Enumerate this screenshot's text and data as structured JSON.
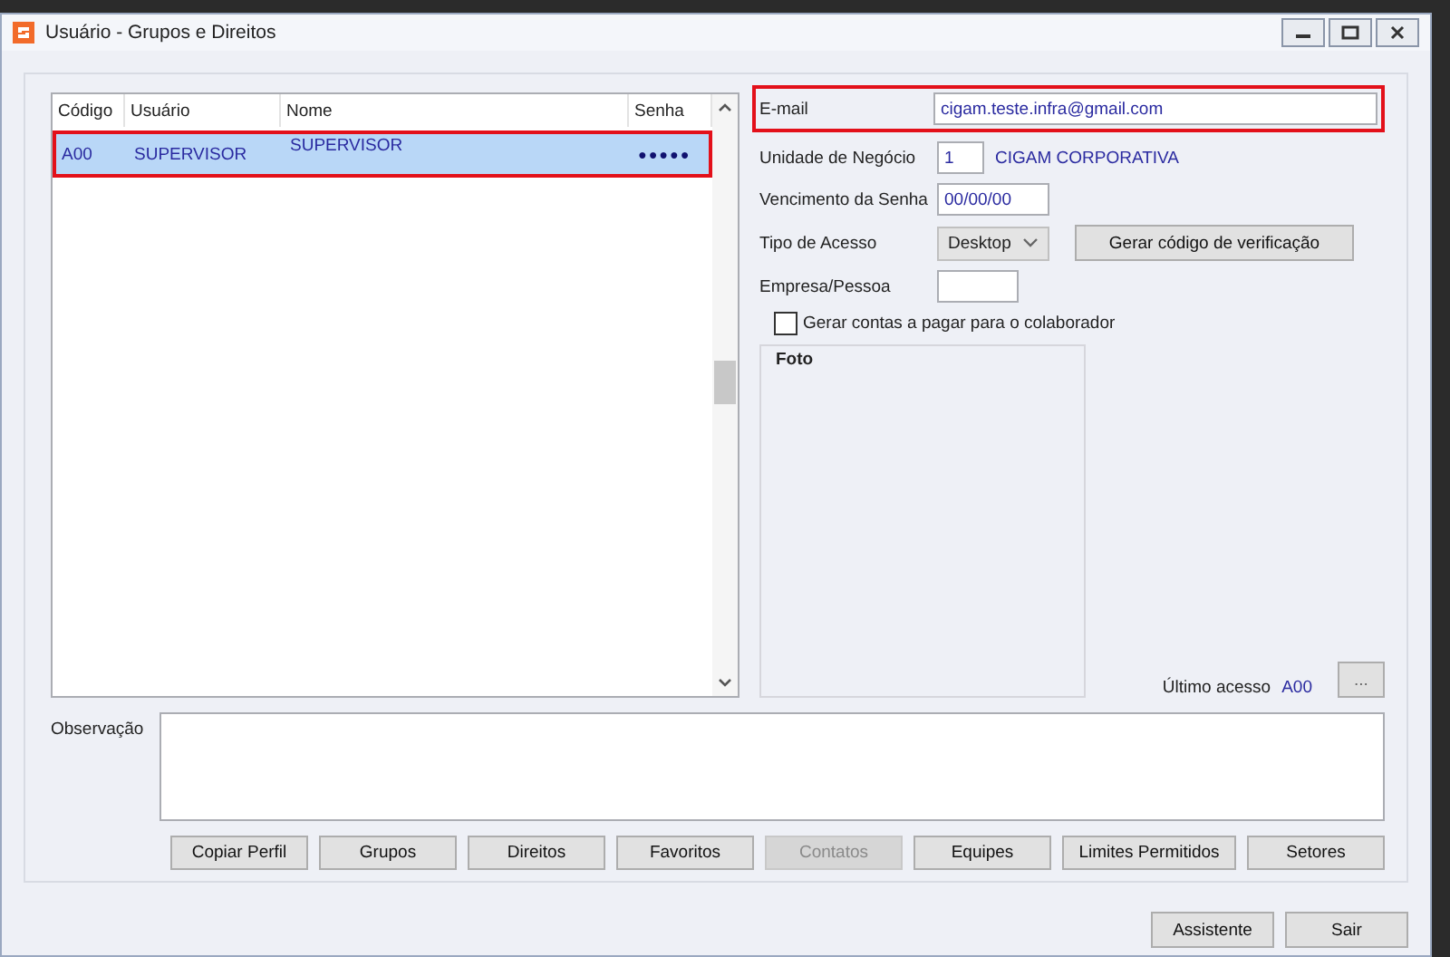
{
  "window": {
    "title": "Usuário - Grupos e Direitos"
  },
  "table": {
    "columns": [
      "Código",
      "Usuário",
      "Nome",
      "Senha"
    ],
    "rows": [
      {
        "cells": [
          "A00",
          "SUPERVISOR",
          "SUPERVISOR",
          "●●●●●"
        ],
        "selected": true,
        "highlighted": true
      }
    ]
  },
  "form": {
    "email": {
      "label": "E-mail",
      "value": "cigam.teste.infra@gmail.com",
      "highlighted": true
    },
    "unidade": {
      "label": "Unidade de Negócio",
      "value": "1",
      "name": "CIGAM CORPORATIVA"
    },
    "vencimento": {
      "label": "Vencimento da Senha",
      "value": "00/00/00"
    },
    "tipo": {
      "label": "Tipo de Acesso",
      "value": "Desktop",
      "button": "Gerar código de verificação"
    },
    "empresa": {
      "label": "Empresa/Pessoa"
    },
    "checkbox": {
      "label": "Gerar contas a pagar para o colaborador",
      "checked": false
    },
    "foto": {
      "label": "Foto"
    },
    "ultimo": {
      "label": "Último acesso",
      "value": "A00",
      "button": "..."
    }
  },
  "observacao": {
    "label": "Observação"
  },
  "actions": [
    {
      "label": "Copiar Perfil",
      "disabled": false
    },
    {
      "label": "Grupos",
      "disabled": false
    },
    {
      "label": "Direitos",
      "disabled": false
    },
    {
      "label": "Favoritos",
      "disabled": false
    },
    {
      "label": "Contatos",
      "disabled": true
    },
    {
      "label": "Equipes",
      "disabled": false
    },
    {
      "label": "Limites Permitidos",
      "disabled": false
    },
    {
      "label": "Setores",
      "disabled": false
    }
  ],
  "footer": [
    "Assistente",
    "Sair"
  ]
}
